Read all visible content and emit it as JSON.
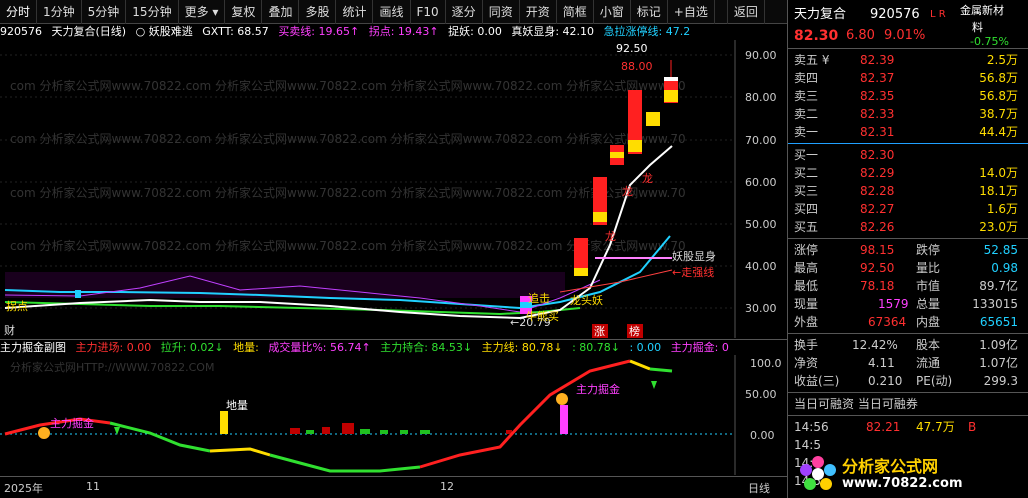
{
  "toolbar": {
    "items": [
      "分时",
      "1分钟",
      "5分钟",
      "15分钟",
      "更多 ▾",
      "复权",
      "叠加",
      "多股",
      "统计",
      "画线",
      "F10",
      "逐分",
      "同资",
      "开资",
      "简框",
      "小窗",
      "标记",
      "+自选",
      "返回"
    ]
  },
  "main_info": {
    "code": "920576",
    "name": "天力复合(日线)",
    "tag": "○ 妖股难逃",
    "gxtt": "GXTT: 68.57",
    "maimai": "买卖线: 19.65↑",
    "guaidian": "拐点: 19.43↑",
    "zhuoyao": "捉妖: 0.00",
    "zhenyao": "真妖显身: 42.10",
    "jila": "急拉涨停线: 47.2"
  },
  "main_labels": {
    "p1": "92.50",
    "p2": "88.00",
    "low": "←20.79",
    "yao": "妖股显身",
    "zou": "←走强线",
    "l1": "追击",
    "l2": "龙头妖",
    "l3": "牛熊买",
    "l4": "拐点",
    "l5": "财",
    "l6": "涨",
    "l7": "榜",
    "l8": "龙",
    "l9": "龙",
    "l10": "龙"
  },
  "main_axis": [
    "90.00",
    "80.00",
    "70.00",
    "60.00",
    "50.00",
    "40.00",
    "30.00"
  ],
  "sub_info": {
    "title": "主力掘金副图",
    "a": "主力进场: 0.00",
    "b": "拉升: 0.02↓",
    "c": "地量:",
    "d": "成交量比%: 56.74↑",
    "e": "主力持合: 84.53↓",
    "f": "主力线: 80.78↓",
    "g": ": 80.78↓",
    "h": ": 0.00",
    "i": "主力掘金: 0"
  },
  "sub_labels": {
    "l1": "主力掘金",
    "l2": "地量",
    "l3": "主力掘金"
  },
  "sub_axis": [
    "100.0",
    "50.00",
    "0.00"
  ],
  "date_axis": {
    "d1": "2025年",
    "d2": "11",
    "d3": "12",
    "d4": "日线"
  },
  "quote": {
    "name": "天力复合",
    "code": "920576",
    "flag": "L R",
    "sector1": "金属新材",
    "sector2": "料",
    "sector_pct": "-0.75%",
    "price": "82.30",
    "change": "6.80",
    "pct": "9.01%",
    "asks": [
      {
        "label": "卖五 ¥",
        "price": "82.39",
        "vol": "2.5万"
      },
      {
        "label": "卖四",
        "price": "82.37",
        "vol": "56.8万"
      },
      {
        "label": "卖三",
        "price": "82.35",
        "vol": "56.8万"
      },
      {
        "label": "卖二",
        "price": "82.33",
        "vol": "38.7万"
      },
      {
        "label": "卖一",
        "price": "82.31",
        "vol": "44.4万"
      }
    ],
    "bids": [
      {
        "label": "买一",
        "price": "82.30",
        "vol": ""
      },
      {
        "label": "买二",
        "price": "82.29",
        "vol": "14.0万"
      },
      {
        "label": "买三",
        "price": "82.28",
        "vol": "18.1万"
      },
      {
        "label": "买四",
        "price": "82.27",
        "vol": "1.6万"
      },
      {
        "label": "买五",
        "price": "82.26",
        "vol": "23.0万"
      }
    ],
    "stats1": [
      {
        "a": "涨停",
        "av": "98.15",
        "b": "跌停",
        "bv": "52.85"
      },
      {
        "a": "最高",
        "av": "92.50",
        "b": "量比",
        "bv": "0.98"
      },
      {
        "a": "最低",
        "av": "78.18",
        "b": "市值",
        "bv": "89.7亿"
      },
      {
        "a": "现量",
        "av": "1579",
        "b": "总量",
        "bv": "133015"
      },
      {
        "a": "外盘",
        "av": "67364",
        "b": "内盘",
        "bv": "65651"
      }
    ],
    "stats2": [
      {
        "a": "换手",
        "av": "12.42%",
        "b": "股本",
        "bv": "1.09亿"
      },
      {
        "a": "净资",
        "av": "4.11",
        "b": "流通",
        "bv": "1.07亿"
      },
      {
        "a": "收益(三)",
        "av": "0.210",
        "b": "PE(动)",
        "bv": "299.3"
      }
    ],
    "margin": "当日可融资 当日可融券",
    "ticks": [
      {
        "t": "14:56",
        "p": "82.21",
        "v": "47.7万",
        "f": "B"
      },
      {
        "t": "14:5",
        "p": "",
        "v": "",
        "f": ""
      },
      {
        "t": "14:5",
        "p": "",
        "v": "",
        "f": ""
      },
      {
        "t": "14:5",
        "p": "",
        "v": "",
        "f": ""
      }
    ],
    "wm1": "分析家公式网",
    "wm2": "www.70822.com"
  },
  "colors": {
    "up": "#ff3030",
    "down": "#30e030",
    "yellow": "#ffdd00",
    "cyan": "#20d0ff",
    "magenta": "#ff40ff",
    "white": "#ffffff"
  }
}
